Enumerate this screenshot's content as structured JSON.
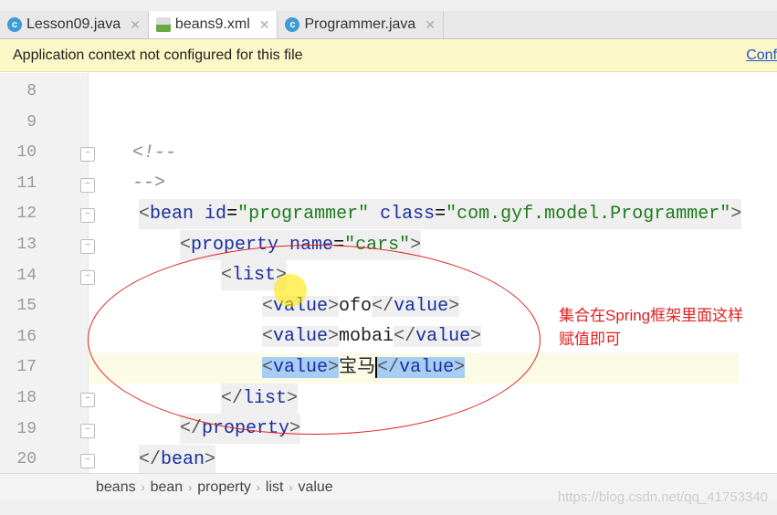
{
  "tabs": [
    {
      "label": "Lesson09.java",
      "icon": "java-class-icon"
    },
    {
      "label": "beans9.xml",
      "icon": "xml-file-icon",
      "active": true
    },
    {
      "label": "Programmer.java",
      "icon": "java-class-icon"
    }
  ],
  "banner": {
    "text": "Application context not configured for this file",
    "link": "Conf"
  },
  "line_numbers": [
    "8",
    "9",
    "10",
    "11",
    "12",
    "13",
    "14",
    "15",
    "16",
    "17",
    "18",
    "19",
    "20"
  ],
  "code": {
    "c1": "<!--",
    "c2": "-->",
    "bean_tag": "bean",
    "id_attr": "id",
    "id_val": "\"programmer\"",
    "class_attr": "class",
    "class_val": "\"com.gyf.model.Programmer\"",
    "property_tag": "property",
    "name_attr": "name",
    "name_val": "\"cars\"",
    "list_tag": "list",
    "value_tag": "value",
    "values": [
      "ofo",
      "mobai",
      "宝马"
    ]
  },
  "breadcrumb": [
    "beans",
    "bean",
    "property",
    "list",
    "value"
  ],
  "annotation": {
    "line1": "集合在Spring框架里面这样",
    "line2": "赋值即可"
  },
  "watermark": "https://blog.csdn.net/qq_41753340"
}
